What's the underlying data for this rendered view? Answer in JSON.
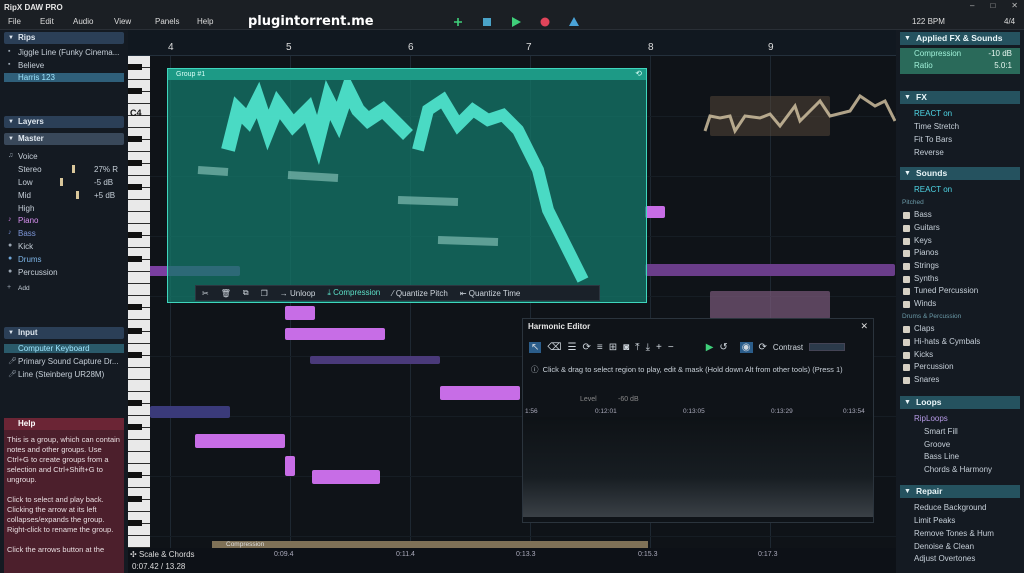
{
  "app": {
    "title": "RipX DAW PRO",
    "watermark": "plugintorrent.me",
    "bpm": "122 BPM",
    "time_signature": "4/4"
  },
  "menu": [
    "File",
    "Edit",
    "Audio",
    "View",
    "Panels",
    "Help"
  ],
  "window_controls": [
    "–",
    "□",
    "✕"
  ],
  "left": {
    "rips_header": "Rips",
    "rips": [
      "Jiggle Line (Funky Cinema...",
      "Believe",
      "Harris 123"
    ],
    "layers_header": "Layers",
    "master_header": "Master",
    "mix": {
      "voice": "Voice",
      "stereo": "Stereo",
      "stereo_val": "27% R",
      "low": "Low",
      "low_val": "-5 dB",
      "mid": "Mid",
      "mid_val": "+5 dB",
      "high": "High"
    },
    "layers": [
      "Piano",
      "Bass",
      "Kick",
      "Drums",
      "Percussion"
    ],
    "add": "Add",
    "input_header": "Input",
    "inputs": [
      "Computer Keyboard",
      "Primary Sound Capture Dr...",
      "Line (Steinberg UR28M)"
    ],
    "help_header": "Help",
    "help_text": "This is a group, which can contain notes and other groups. Use Ctrl+G to create groups from a selection and Ctrl+Shift+G to ungroup.\n\nClick to select and play back. Clicking the arrow at its left collapses/expands the group. Right-click to rename the group.\n\nClick the arrows button at the"
  },
  "ruler": [
    "4",
    "5",
    "6",
    "7",
    "8",
    "9"
  ],
  "key_label": "C4",
  "group": {
    "name": "Group #1",
    "toolbar": [
      "Unloop",
      "Compression",
      "Quantize Pitch",
      "Quantize Time"
    ]
  },
  "harmonic": {
    "title": "Harmonic Editor",
    "contrast_label": "Contrast",
    "hint": "Click & drag to select region to play, edit & mask (Hold down Alt from other tools)  (Press 1)",
    "level_label": "Level",
    "level_val": "-60 dB",
    "times": [
      "1:56",
      "0:12:01",
      "0:13:05",
      "0:13:29",
      "0:13:54"
    ]
  },
  "right": {
    "applied_header": "Applied FX & Sounds",
    "applied": [
      {
        "name": "Compression",
        "val": "-10 dB"
      },
      {
        "name": "Ratio",
        "val": "5.0:1"
      }
    ],
    "fx_header": "FX",
    "fx": [
      "REACT on",
      "Time Stretch",
      "Fit To Bars",
      "Reverse"
    ],
    "sounds_header": "Sounds",
    "sounds_react": "REACT on",
    "pitched_label": "Pitched",
    "pitched": [
      "Bass",
      "Guitars",
      "Keys",
      "Pianos",
      "Strings",
      "Synths",
      "Tuned Percussion",
      "Winds"
    ],
    "drums_label": "Drums & Percussion",
    "drums": [
      "Claps",
      "Hi-hats & Cymbals",
      "Kicks",
      "Percussion",
      "Snares"
    ],
    "loops_header": "Loops",
    "riploops": "RipLoops",
    "loops": [
      "Smart Fill",
      "Groove",
      "Bass Line",
      "Chords & Harmony"
    ],
    "repair_header": "Repair",
    "repair": [
      "Reduce Background",
      "Limit Peaks",
      "Remove Tones & Hum",
      "Denoise & Clean",
      "Adjust Overtones"
    ]
  },
  "bottom": {
    "scale_chords": "Scale & Chords",
    "clock": "0:07.42 / 13.28",
    "compression_strip": "Compression",
    "times": [
      "0:09.4",
      "0:11.4",
      "0:13.3",
      "0:15.3",
      "0:17.3"
    ]
  }
}
